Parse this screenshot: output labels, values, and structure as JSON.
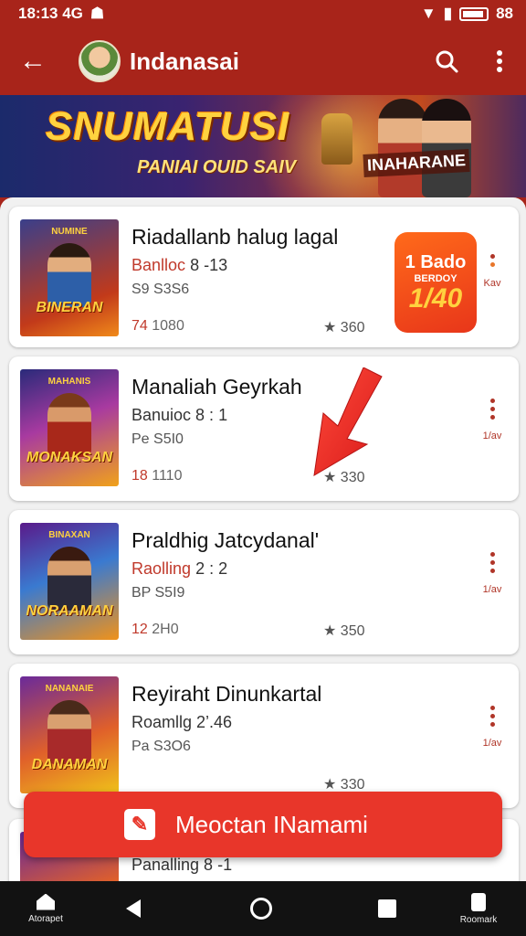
{
  "status_bar": {
    "time": "18:13 4G",
    "battery": "88"
  },
  "app_bar": {
    "title": "Indanasai"
  },
  "banner": {
    "title": "SNUMATUSI",
    "subtitle": "PANIAI OUID SAIV",
    "tagline": "INAHARANE"
  },
  "cards": [
    {
      "title": "Riadallanb halug lagal",
      "line2_accent": "Banlloc",
      "line2_rest": "8 -13",
      "line3": "S9 S3S6",
      "price": "74",
      "price_suffix": "1080",
      "rating": "★ 360",
      "thumb_top": "NUMINE",
      "thumb_label": "BINERAN",
      "more_label": "Kav",
      "promo": {
        "top": "1 Bado",
        "mid": "BERDOY",
        "big": "1/40"
      }
    },
    {
      "title": "Manaliah Geyrkah",
      "line2_accent": "",
      "line2_rest": "Banuioc 8 : 1",
      "line3": "Pe S5I0",
      "price": "18",
      "price_suffix": "1110",
      "rating": "★ 330",
      "thumb_top": "MAHANIS",
      "thumb_label": "MONAKSAN",
      "more_label": "1/av"
    },
    {
      "title": "Praldhig Jatcydanal'",
      "line2_accent": "Raolling",
      "line2_rest": "2 : 2",
      "line3": "BP S5I9",
      "price": "12",
      "price_suffix": "2H0",
      "rating": "★ 350",
      "thumb_top": "BINAXAN",
      "thumb_label": "NORAAMAN",
      "more_label": "1/av"
    },
    {
      "title": "Reyiraht Dinunkartal",
      "line2_accent": "",
      "line2_rest": "Roamllg 2’.46",
      "line3": "Pa S3O6",
      "price": "",
      "price_suffix": "",
      "rating": "★ 330",
      "thumb_top": "NANANAIE",
      "thumb_label": "DANAMAN",
      "more_label": "1/av"
    },
    {
      "title": "",
      "line2_accent": "",
      "line2_rest": "Panalling 8 -1",
      "line3": "",
      "price": "",
      "price_suffix": "",
      "rating": "",
      "thumb_top": "",
      "thumb_label": "",
      "more_label": ""
    }
  ],
  "fab": {
    "label": "Meoctan INamami"
  },
  "nav": {
    "home_label": "Atorapet",
    "right_label": "Roomark"
  }
}
